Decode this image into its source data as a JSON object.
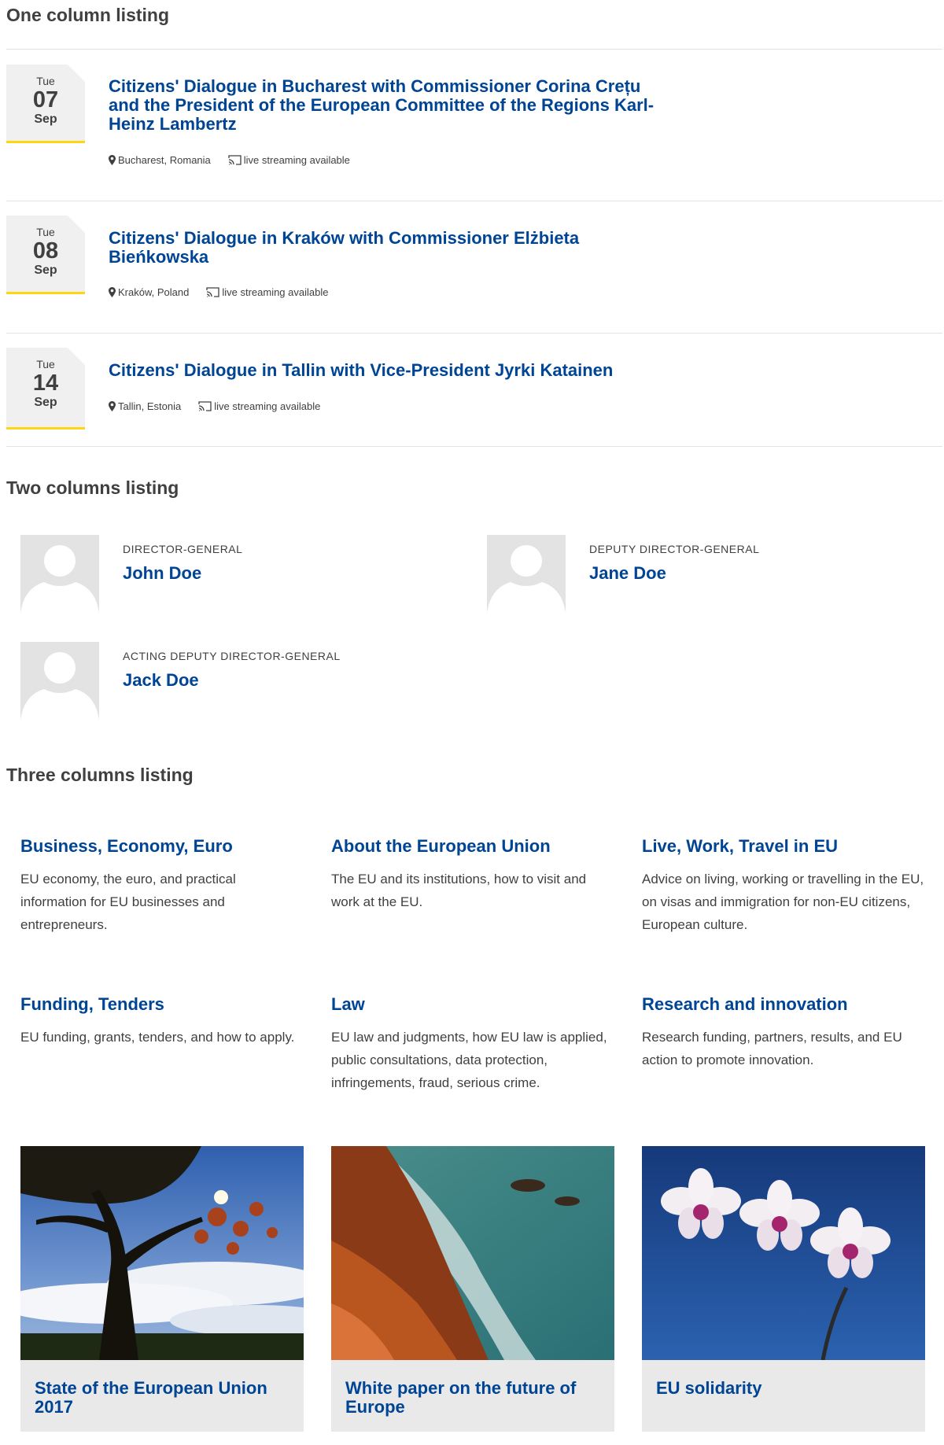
{
  "sections": {
    "one_col": "One column listing",
    "two_col": "Two columns listing",
    "three_col": "Three columns listing"
  },
  "events": [
    {
      "dow": "Tue",
      "day": "07",
      "month": "Sep",
      "title": "Citizens' Dialogue in Bucharest with Commissioner Corina Crețu and the President of the European Committee of the Regions Karl-Heinz Lambertz",
      "location": "Bucharest, Romania",
      "streaming": "live streaming available"
    },
    {
      "dow": "Tue",
      "day": "08",
      "month": "Sep",
      "title": "Citizens' Dialogue in Kraków with Commissioner Elżbieta Bieńkowska",
      "location": "Kraków, Poland",
      "streaming": "live streaming available"
    },
    {
      "dow": "Tue",
      "day": "14",
      "month": "Sep",
      "title": "Citizens' Dialogue in Tallin with Vice-President Jyrki Katainen",
      "location": "Tallin, Estonia",
      "streaming": "live streaming available"
    }
  ],
  "people": [
    {
      "role": "DIRECTOR-GENERAL",
      "name": "John Doe"
    },
    {
      "role": "DEPUTY DIRECTOR-GENERAL",
      "name": "Jane Doe"
    },
    {
      "role": "ACTING DEPUTY DIRECTOR-GENERAL",
      "name": "Jack Doe"
    }
  ],
  "topics": [
    {
      "title": "Business, Economy, Euro",
      "desc": "EU economy, the euro, and practical information for EU businesses and entrepreneurs."
    },
    {
      "title": "About the European Union",
      "desc": "The EU and its institutions, how to visit and work at the EU."
    },
    {
      "title": "Live, Work, Travel in EU",
      "desc": "Advice on living, working or travelling in the EU, on visas and immigration for non-EU citizens, European culture."
    },
    {
      "title": "Funding, Tenders",
      "desc": "EU funding, grants, tenders, and how to apply."
    },
    {
      "title": "Law",
      "desc": "EU law and judgments, how EU law is applied, public consultations, data protection, infringements, fraud, serious crime."
    },
    {
      "title": "Research and innovation",
      "desc": "Research funding, partners, results, and EU action to promote innovation."
    }
  ],
  "cards": [
    {
      "title": "State of the European Union 2017",
      "image": "tree-sky-photo"
    },
    {
      "title": "White paper on the future of Europe",
      "image": "rocky-coast-photo"
    },
    {
      "title": "EU solidarity",
      "image": "orchid-photo"
    }
  ],
  "colors": {
    "link": "#004494",
    "accent": "#ffd617",
    "text": "#404040",
    "date_bg": "#f0f0f0",
    "card_bg": "#e9e9e9"
  }
}
